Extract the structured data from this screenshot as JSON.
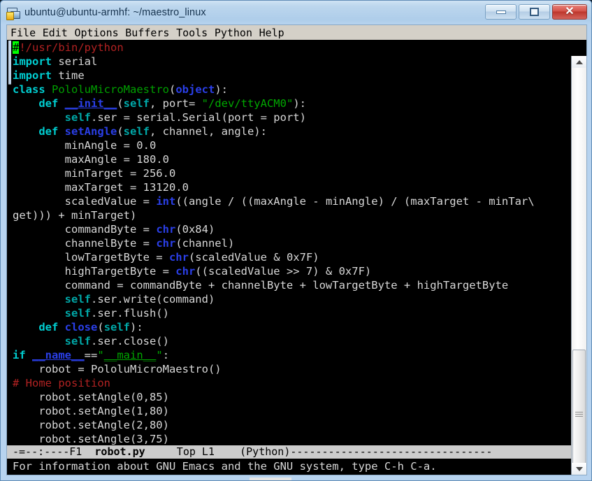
{
  "window": {
    "title": "ubuntu@ubuntu-armhf: ~/maestro_linux",
    "icon": "computer-network-icon",
    "controls": {
      "minimize": "minimize-icon",
      "maximize": "maximize-icon",
      "close": "✕"
    },
    "frame_color": "#aecdea",
    "titlebar_text_color": "#16334f"
  },
  "menubar": {
    "items": [
      {
        "label": "File"
      },
      {
        "label": "Edit"
      },
      {
        "label": "Options"
      },
      {
        "label": "Buffers"
      },
      {
        "label": "Tools"
      },
      {
        "label": "Python"
      },
      {
        "label": "Help"
      }
    ]
  },
  "editor": {
    "background": "#000000",
    "foreground": "#d8d8d8",
    "cursor_char": "#",
    "cursor_color": "#00ff00",
    "lines": [
      {
        "id": 1,
        "segments": [
          {
            "t": "#",
            "c": "cursor"
          },
          {
            "t": "!/usr/bin/python",
            "c": "cmt"
          }
        ]
      },
      {
        "id": 2,
        "segments": [
          {
            "t": "import",
            "c": "kw"
          },
          {
            "t": " serial",
            "c": "plain"
          }
        ]
      },
      {
        "id": 3,
        "segments": [
          {
            "t": "import",
            "c": "kw"
          },
          {
            "t": " time",
            "c": "plain"
          }
        ]
      },
      {
        "id": 4,
        "segments": [
          {
            "t": "class",
            "c": "kw"
          },
          {
            "t": " ",
            "c": "plain"
          },
          {
            "t": "PololuMicroMaestro",
            "c": "fn"
          },
          {
            "t": "(",
            "c": "plain"
          },
          {
            "t": "object",
            "c": "bi"
          },
          {
            "t": "):",
            "c": "plain"
          }
        ]
      },
      {
        "id": 5,
        "segments": [
          {
            "t": "    ",
            "c": "plain"
          },
          {
            "t": "def",
            "c": "kw"
          },
          {
            "t": " ",
            "c": "plain"
          },
          {
            "t": "__init__",
            "c": "dund"
          },
          {
            "t": "(",
            "c": "plain"
          },
          {
            "t": "self",
            "c": "selfk"
          },
          {
            "t": ", port= ",
            "c": "plain"
          },
          {
            "t": "\"/dev/ttyACM0\"",
            "c": "str"
          },
          {
            "t": "):",
            "c": "plain"
          }
        ]
      },
      {
        "id": 6,
        "segments": [
          {
            "t": "        ",
            "c": "plain"
          },
          {
            "t": "self",
            "c": "selfk"
          },
          {
            "t": ".ser = serial.Serial(port = port)",
            "c": "plain"
          }
        ]
      },
      {
        "id": 7,
        "segments": [
          {
            "t": "    ",
            "c": "plain"
          },
          {
            "t": "def",
            "c": "kw"
          },
          {
            "t": " ",
            "c": "plain"
          },
          {
            "t": "setAngle",
            "c": "bi"
          },
          {
            "t": "(",
            "c": "plain"
          },
          {
            "t": "self",
            "c": "selfk"
          },
          {
            "t": ", channel, angle):",
            "c": "plain"
          }
        ]
      },
      {
        "id": 8,
        "segments": [
          {
            "t": "        minAngle = 0.0",
            "c": "plain"
          }
        ]
      },
      {
        "id": 9,
        "segments": [
          {
            "t": "        maxAngle = 180.0",
            "c": "plain"
          }
        ]
      },
      {
        "id": 10,
        "segments": [
          {
            "t": "        minTarget = 256.0",
            "c": "plain"
          }
        ]
      },
      {
        "id": 11,
        "segments": [
          {
            "t": "        maxTarget = 13120.0",
            "c": "plain"
          }
        ]
      },
      {
        "id": 12,
        "segments": [
          {
            "t": "        scaledValue = ",
            "c": "plain"
          },
          {
            "t": "int",
            "c": "bi"
          },
          {
            "t": "((angle / ((maxAngle - minAngle) / (maxTarget - minTar\\",
            "c": "plain"
          }
        ]
      },
      {
        "id": 13,
        "segments": [
          {
            "t": "get))) + minTarget)",
            "c": "plain"
          }
        ]
      },
      {
        "id": 14,
        "segments": [
          {
            "t": "        commandByte = ",
            "c": "plain"
          },
          {
            "t": "chr",
            "c": "bi"
          },
          {
            "t": "(0x84)",
            "c": "plain"
          }
        ]
      },
      {
        "id": 15,
        "segments": [
          {
            "t": "        channelByte = ",
            "c": "plain"
          },
          {
            "t": "chr",
            "c": "bi"
          },
          {
            "t": "(channel)",
            "c": "plain"
          }
        ]
      },
      {
        "id": 16,
        "segments": [
          {
            "t": "        lowTargetByte = ",
            "c": "plain"
          },
          {
            "t": "chr",
            "c": "bi"
          },
          {
            "t": "(scaledValue & 0x7F)",
            "c": "plain"
          }
        ]
      },
      {
        "id": 17,
        "segments": [
          {
            "t": "        highTargetByte = ",
            "c": "plain"
          },
          {
            "t": "chr",
            "c": "bi"
          },
          {
            "t": "((scaledValue >> 7) & 0x7F)",
            "c": "plain"
          }
        ]
      },
      {
        "id": 18,
        "segments": [
          {
            "t": "        command = commandByte + channelByte + lowTargetByte + highTargetByte",
            "c": "plain"
          }
        ]
      },
      {
        "id": 19,
        "segments": [
          {
            "t": "        ",
            "c": "plain"
          },
          {
            "t": "self",
            "c": "selfk"
          },
          {
            "t": ".ser.write(command)",
            "c": "plain"
          }
        ]
      },
      {
        "id": 20,
        "segments": [
          {
            "t": "        ",
            "c": "plain"
          },
          {
            "t": "self",
            "c": "selfk"
          },
          {
            "t": ".ser.flush()",
            "c": "plain"
          }
        ]
      },
      {
        "id": 21,
        "segments": [
          {
            "t": "    ",
            "c": "plain"
          },
          {
            "t": "def",
            "c": "kw"
          },
          {
            "t": " ",
            "c": "plain"
          },
          {
            "t": "close",
            "c": "bi"
          },
          {
            "t": "(",
            "c": "plain"
          },
          {
            "t": "self",
            "c": "selfk"
          },
          {
            "t": "):",
            "c": "plain"
          }
        ]
      },
      {
        "id": 22,
        "segments": [
          {
            "t": "        ",
            "c": "plain"
          },
          {
            "t": "self",
            "c": "selfk"
          },
          {
            "t": ".ser.close()",
            "c": "plain"
          }
        ]
      },
      {
        "id": 23,
        "segments": [
          {
            "t": "if",
            "c": "kw"
          },
          {
            "t": " ",
            "c": "plain"
          },
          {
            "t": "__name__",
            "c": "dund"
          },
          {
            "t": "==",
            "c": "plain"
          },
          {
            "t": "\"",
            "c": "str"
          },
          {
            "t": "__main__",
            "c": "dundg"
          },
          {
            "t": "\"",
            "c": "str"
          },
          {
            "t": ":",
            "c": "plain"
          }
        ]
      },
      {
        "id": 24,
        "segments": [
          {
            "t": "    robot = PololuMicroMaestro()",
            "c": "plain"
          }
        ]
      },
      {
        "id": 25,
        "segments": [
          {
            "t": "# Home position",
            "c": "cmt"
          }
        ]
      },
      {
        "id": 26,
        "segments": [
          {
            "t": "    robot.setAngle(0,85)",
            "c": "plain"
          }
        ]
      },
      {
        "id": 27,
        "segments": [
          {
            "t": "    robot.setAngle(1,80)",
            "c": "plain"
          }
        ]
      },
      {
        "id": 28,
        "segments": [
          {
            "t": "    robot.setAngle(2,80)",
            "c": "plain"
          }
        ]
      },
      {
        "id": 29,
        "segments": [
          {
            "t": "    robot.setAngle(3,75)",
            "c": "plain"
          }
        ]
      }
    ]
  },
  "modeline": {
    "prefix": "-=--:----F1  ",
    "buffer": "robot.py",
    "position": "     Top L1    ",
    "mode": "(Python)",
    "filler": "--------------------------------"
  },
  "minibuffer": {
    "message": "For information about GNU Emacs and the GNU system, type C-h C-a."
  },
  "scrollbar": {
    "up_arrow": "scroll-up-icon",
    "down_arrow": "scroll-down-icon",
    "thumb": "scroll-thumb"
  }
}
